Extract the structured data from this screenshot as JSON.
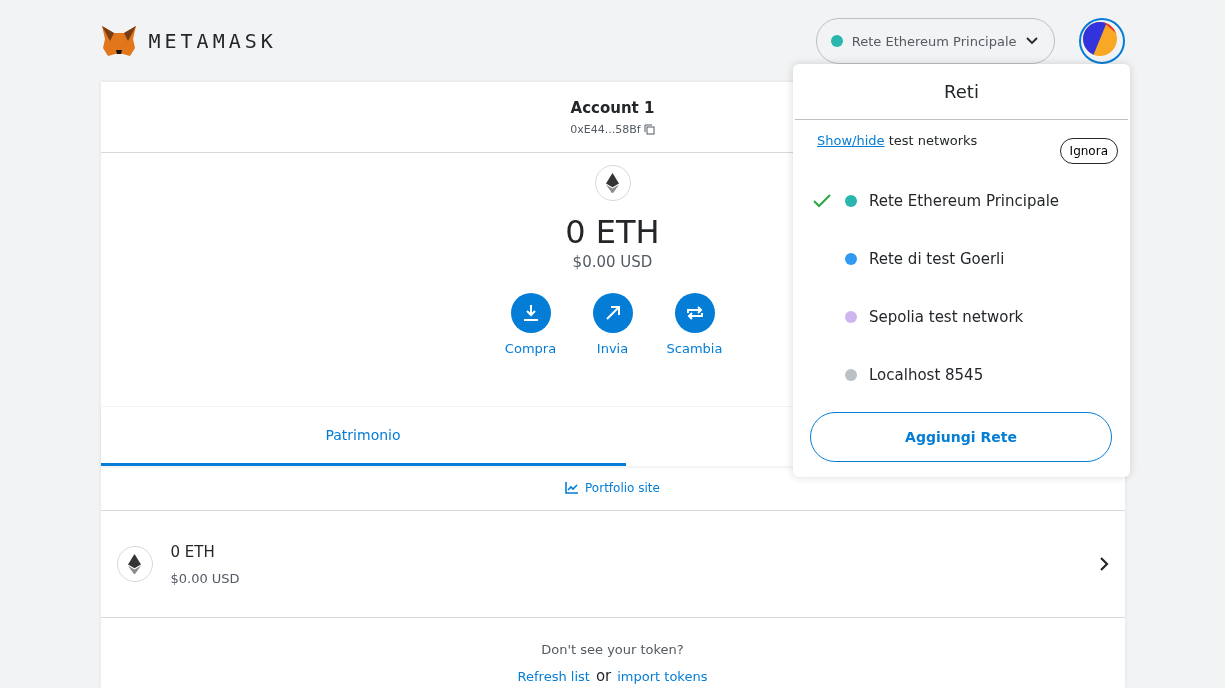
{
  "header": {
    "brand": "METAMASK",
    "network": {
      "name": "Rete Ethereum Principale",
      "color": "#29b6af"
    }
  },
  "account": {
    "name": "Account 1",
    "address": "0xE44...58Bf"
  },
  "balance": {
    "amount": "0 ETH",
    "fiat": "$0.00 USD"
  },
  "actions": [
    {
      "kind": "buy",
      "label": "Compra"
    },
    {
      "kind": "send",
      "label": "Invia"
    },
    {
      "kind": "swap",
      "label": "Scambia"
    }
  ],
  "tabs": [
    {
      "label": "Patrimonio",
      "selected": true
    }
  ],
  "portfolio_link": "Portfolio site",
  "assets": [
    {
      "amount": "0 ETH",
      "fiat": "$0.00 USD"
    }
  ],
  "footer": {
    "question": "Don't see your token?",
    "refresh": "Refresh list",
    "or": "or",
    "import": "import tokens"
  },
  "network_menu": {
    "title": "Reti",
    "link": "Show/hide",
    "hint": "test networks",
    "dismiss": "Ignora",
    "networks": [
      {
        "name": "Rete Ethereum Principale",
        "color": "#29b6af",
        "selected": true
      },
      {
        "name": "Rete di test Goerli",
        "color": "#3099f2",
        "selected": false
      },
      {
        "name": "Sepolia test network",
        "color": "#cfb5f0",
        "selected": false
      },
      {
        "name": "Localhost 8545",
        "color": "#bbc0c5",
        "selected": false
      }
    ],
    "add_button": "Aggiungi Rete"
  }
}
